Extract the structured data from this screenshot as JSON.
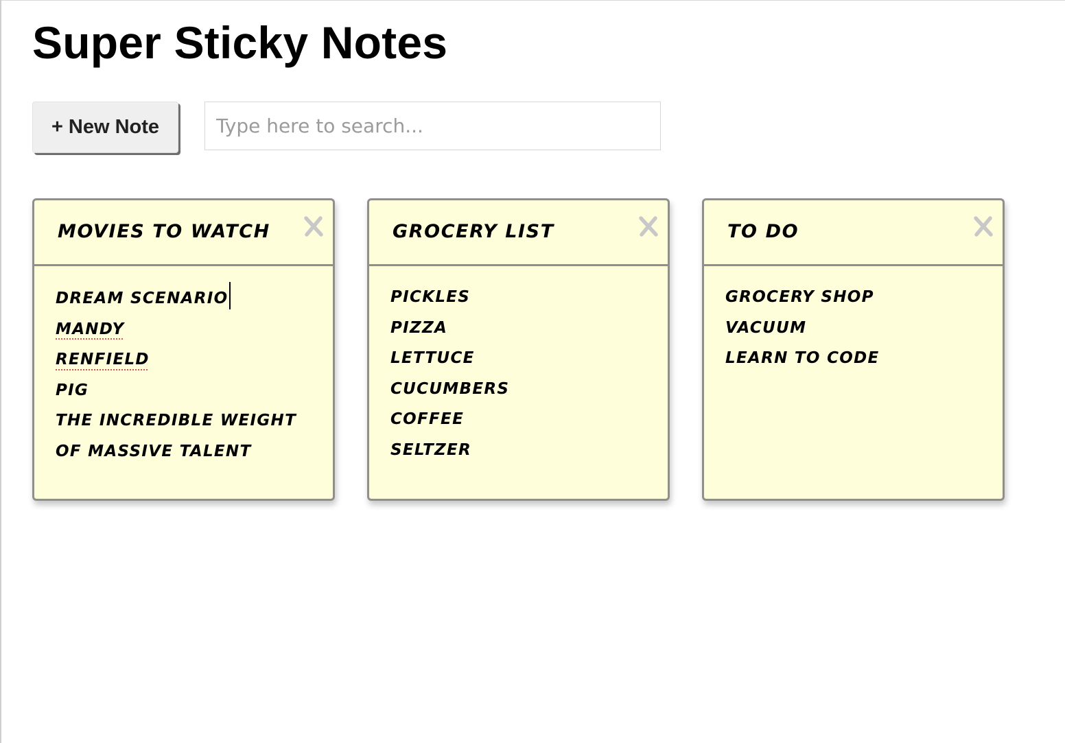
{
  "app": {
    "title": "Super Sticky Notes"
  },
  "toolbar": {
    "new_note_label": "+ New Note",
    "search_placeholder": "Type here to search...",
    "search_value": ""
  },
  "notes": [
    {
      "title": "Movies to watch",
      "close_icon": "close-x-icon",
      "lines": [
        "Dream scenario",
        "Mandy",
        "Renfield",
        "Pig",
        "The Incredible Weight",
        "of Massive Talent"
      ]
    },
    {
      "title": "Grocery list",
      "close_icon": "close-x-icon",
      "lines": [
        "Pickles",
        "Pizza",
        "Lettuce",
        "Cucumbers",
        "Coffee",
        "Seltzer"
      ]
    },
    {
      "title": "To do",
      "close_icon": "close-x-icon",
      "lines": [
        "Grocery shop",
        "Vacuum",
        "Learn to code"
      ]
    }
  ],
  "colors": {
    "note_background": "#fffedb",
    "note_border": "#8f8f8f",
    "close_icon": "#c8c8c8",
    "spellcheck_underline": "#e05050"
  }
}
